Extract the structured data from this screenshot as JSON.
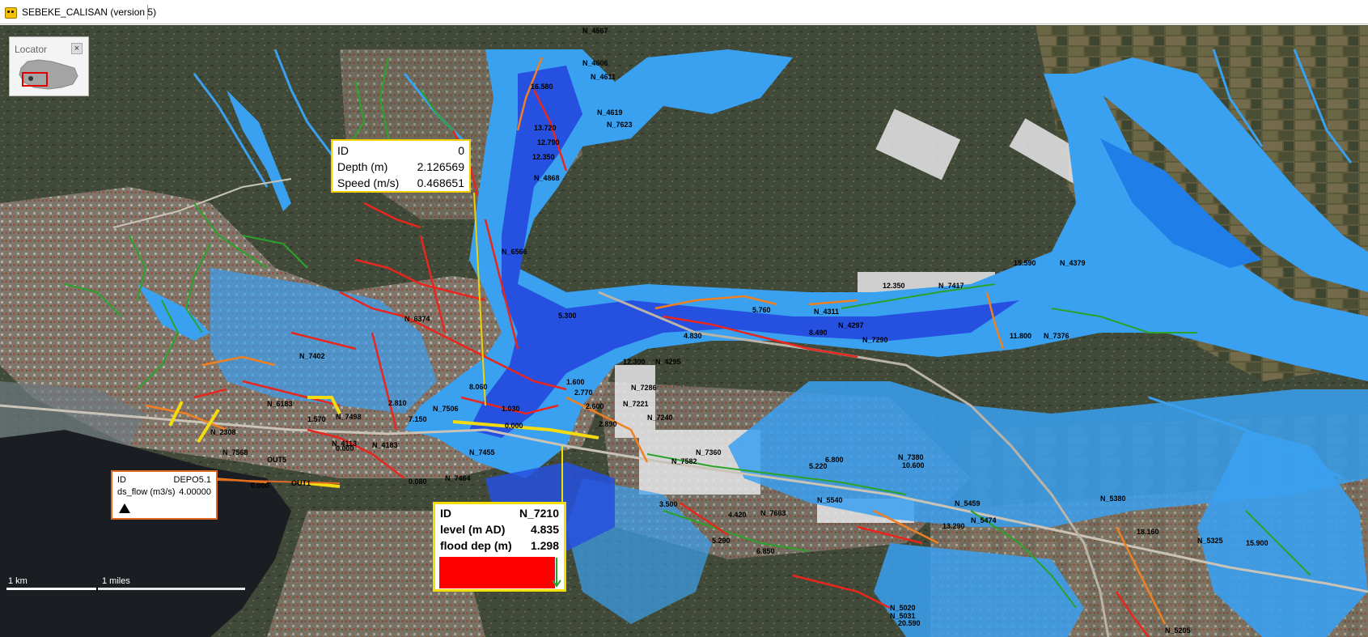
{
  "window": {
    "title": "SEBEKE_CALISAN (version 5)"
  },
  "locator": {
    "title": "Locator",
    "close_glyph": "×"
  },
  "colors": {
    "flood_light": "#3aa0f0",
    "flood_mid": "#1f7ee8",
    "flood_deep": "#2650e0",
    "pipe_red": "#e8261e",
    "pipe_orange": "#f08020",
    "pipe_green": "#2aa32a",
    "pipe_yellow": "#f4dc10",
    "overflow_bar": "#ff0000"
  },
  "tooltips": {
    "flood_point": {
      "rows": [
        {
          "key": "ID",
          "value": "0"
        },
        {
          "key": "Depth (m)",
          "value": "2.126569"
        },
        {
          "key": "Speed (m/s)",
          "value": "0.468651"
        }
      ]
    },
    "depot": {
      "rows": [
        {
          "key": "ID",
          "value": "DEPO5.1"
        },
        {
          "key": "ds_flow (m3/s)",
          "value": "4.00000"
        }
      ],
      "icon": "up-triangle-icon"
    },
    "node": {
      "rows": [
        {
          "key": "ID",
          "value": "N_7210"
        },
        {
          "key": "level (m AD)",
          "value": "4.835"
        },
        {
          "key": "flood dep (m)",
          "value": "1.298"
        }
      ],
      "flood_fraction": 1.0,
      "icon": "down-arrow-icon"
    }
  },
  "scale_bar": {
    "km_label": "1 km",
    "miles_label": "1 miles"
  },
  "node_labels": [
    {
      "t": "N_4567"
    },
    {
      "t": "N_4606"
    },
    {
      "t": "N_4611"
    },
    {
      "t": "N_4619"
    },
    {
      "t": "N_7623"
    },
    {
      "t": "N_4868"
    },
    {
      "t": "N_6566"
    },
    {
      "t": "N_6374"
    },
    {
      "t": "N_7402"
    },
    {
      "t": "N_6183"
    },
    {
      "t": "N_7498"
    },
    {
      "t": "N_4183"
    },
    {
      "t": "N_7455"
    },
    {
      "t": "N_7464"
    },
    {
      "t": "N_7506"
    },
    {
      "t": "N_4113"
    },
    {
      "t": "N_4311"
    },
    {
      "t": "N_4297"
    },
    {
      "t": "N_7290"
    },
    {
      "t": "N_7417"
    },
    {
      "t": "N_4379"
    },
    {
      "t": "N_7376"
    },
    {
      "t": "N_4295"
    },
    {
      "t": "N_7286"
    },
    {
      "t": "N_7221"
    },
    {
      "t": "N_7240"
    },
    {
      "t": "N_7380"
    },
    {
      "t": "N_7582"
    },
    {
      "t": "N_7663"
    },
    {
      "t": "N_5540"
    },
    {
      "t": "N_5459"
    },
    {
      "t": "N_5474"
    },
    {
      "t": "N_5031"
    },
    {
      "t": "N_5205"
    },
    {
      "t": "N_5325"
    },
    {
      "t": "N_5380"
    },
    {
      "t": "N_5020"
    },
    {
      "t": "N_7360"
    },
    {
      "t": "N_2308"
    },
    {
      "t": "N_7568"
    },
    {
      "t": "OUT1"
    },
    {
      "t": "OUT5"
    },
    {
      "t": "12.350"
    },
    {
      "t": "15.590"
    },
    {
      "t": "11.800"
    },
    {
      "t": "16.580"
    },
    {
      "t": "13.720"
    },
    {
      "t": "12.790"
    },
    {
      "t": "12.350"
    },
    {
      "t": "0.000"
    },
    {
      "t": "4.830"
    },
    {
      "t": "5.760"
    },
    {
      "t": "8.490"
    },
    {
      "t": "12.300"
    },
    {
      "t": "2.770"
    },
    {
      "t": "2.600"
    },
    {
      "t": "2.890"
    },
    {
      "t": "1.030"
    },
    {
      "t": "1.570"
    },
    {
      "t": "5.220"
    },
    {
      "t": "4.420"
    },
    {
      "t": "5.290"
    },
    {
      "t": "3.500"
    },
    {
      "t": "10.600"
    },
    {
      "t": "13.290"
    },
    {
      "t": "18.160"
    },
    {
      "t": "15.900"
    },
    {
      "t": "6.800"
    },
    {
      "t": "20.590"
    },
    {
      "t": "6.850"
    },
    {
      "t": "8.060"
    },
    {
      "t": "7.150"
    },
    {
      "t": "5.300"
    },
    {
      "t": "0.000"
    },
    {
      "t": "2.810"
    },
    {
      "t": "0.080"
    },
    {
      "t": "0.000"
    },
    {
      "t": "1.600"
    }
  ]
}
